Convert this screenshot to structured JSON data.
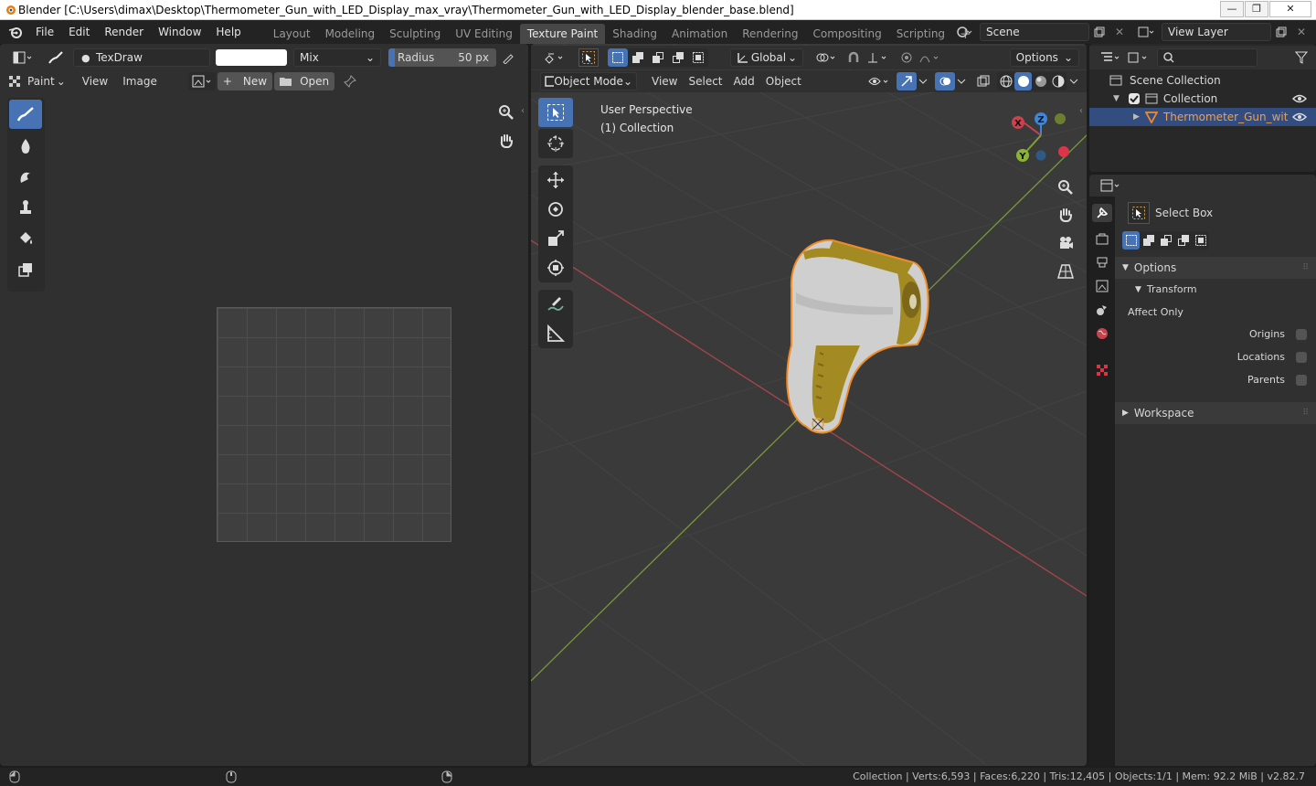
{
  "titlebar": {
    "title": "Blender [C:\\Users\\dimax\\Desktop\\Thermometer_Gun_with_LED_Display_max_vray\\Thermometer_Gun_with_LED_Display_blender_base.blend]",
    "min": "—",
    "max": "❐",
    "close": "✕"
  },
  "menu": [
    "File",
    "Edit",
    "Render",
    "Window",
    "Help"
  ],
  "workspaces": [
    "Layout",
    "Modeling",
    "Sculpting",
    "UV Editing",
    "Texture Paint",
    "Shading",
    "Animation",
    "Rendering",
    "Compositing",
    "Scripting"
  ],
  "workspace_add": "+",
  "scene": {
    "name": "Scene",
    "view_layer": "View Layer"
  },
  "image_editor": {
    "brush_name": "TexDraw",
    "blend_mode": "Mix",
    "radius_label": "Radius",
    "radius_value": "50 px",
    "mode": "Paint",
    "menus": [
      "View",
      "Image"
    ],
    "new_label": "New",
    "open_label": "Open"
  },
  "viewport": {
    "orientation": "Global",
    "options": "Options",
    "mode": "Object Mode",
    "menus": [
      "View",
      "Select",
      "Add",
      "Object"
    ],
    "overlay_title": "User Perspective",
    "overlay_collection": "(1) Collection",
    "gizmo": {
      "x": "X",
      "y": "Y",
      "z": "Z"
    }
  },
  "outliner": {
    "scene_collection": "Scene Collection",
    "collection": "Collection",
    "object": "Thermometer_Gun_with_LE"
  },
  "properties": {
    "tool_name": "Select Box",
    "options_label": "Options",
    "transform_label": "Transform",
    "affect_only": "Affect Only",
    "origins": "Origins",
    "locations": "Locations",
    "parents": "Parents",
    "workspace_label": "Workspace"
  },
  "statusbar": {
    "stats": "Collection | Verts:6,593 | Faces:6,220 | Tris:12,405 | Objects:1/1 | Mem: 92.2 MiB | v2.82.7"
  },
  "colors": {
    "accent": "#4772b3",
    "selected_orange": "#f28a22",
    "x_axis": "#c8434e",
    "y_axis": "#7fa33a",
    "z_axis": "#3e86d8"
  }
}
